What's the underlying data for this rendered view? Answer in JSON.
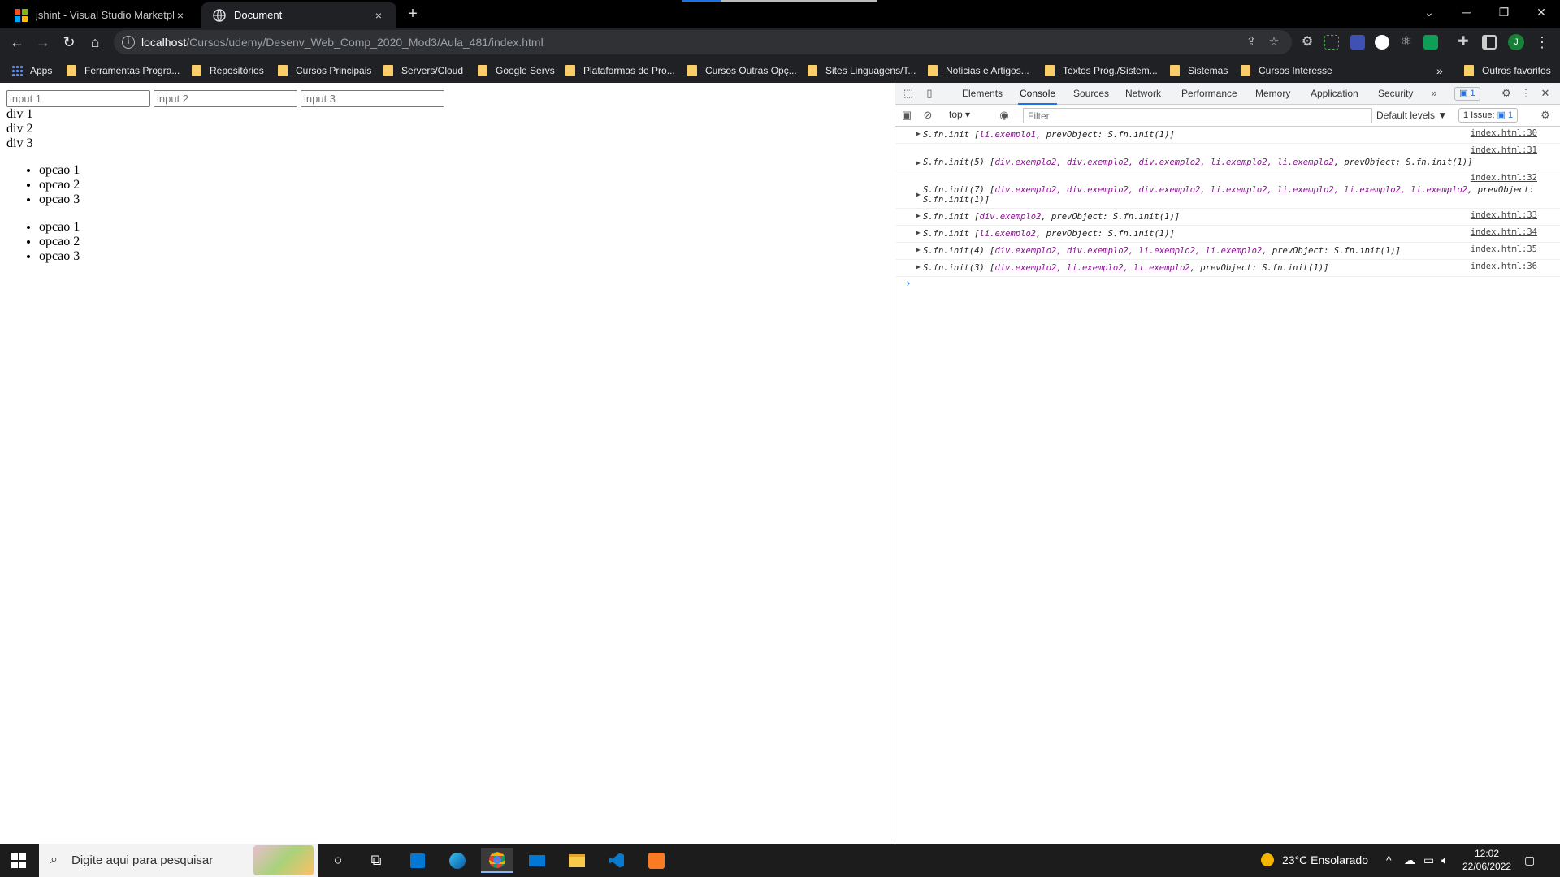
{
  "browser": {
    "tabs": [
      {
        "title": "jshint - Visual Studio Marketplace",
        "close": "×"
      },
      {
        "title": "Document",
        "close": "×"
      }
    ],
    "new_tab": "+",
    "url": {
      "host": "localhost",
      "path": "/Cursos/udemy/Desenv_Web_Comp_2020_Mod3/Aula_481/index.html"
    },
    "profile_initial": "J",
    "bookmarks": [
      "Apps",
      "Ferramentas Progra...",
      "Repositórios",
      "Cursos Principais",
      "Servers/Cloud",
      "Google Servs",
      "Plataformas de Pro...",
      "Cursos Outras Opç...",
      "Sites Linguagens/T...",
      "Noticias e Artigos...",
      "Textos Prog./Sistem...",
      "Sistemas",
      "Cursos Interesse"
    ],
    "bookmarks_more": "»",
    "other_bookmarks": "Outros favoritos"
  },
  "page": {
    "inputs": [
      {
        "placeholder": "input 1"
      },
      {
        "placeholder": "input 2"
      },
      {
        "placeholder": "input 3"
      }
    ],
    "divs": [
      "div 1",
      "div 2",
      "div 3"
    ],
    "list1": [
      "opcao 1",
      "opcao 2",
      "opcao 3"
    ],
    "list2": [
      "opcao 1",
      "opcao 2",
      "opcao 3"
    ]
  },
  "devtools": {
    "tabs": [
      "Elements",
      "Console",
      "Sources",
      "Network",
      "Performance",
      "Memory",
      "Application",
      "Security"
    ],
    "active_tab": "Console",
    "more_tabs": "»",
    "messages_badge": "1",
    "context": "top",
    "filter_placeholder": "Filter",
    "levels": "Default levels ▼",
    "issues": {
      "label": "1 Issue:",
      "count": "1"
    },
    "console": [
      {
        "text_pre": "S.fn.init [",
        "items": "li.exemplo1",
        "text_post": ", prevObject: S.fn.init(1)]",
        "src": "index.html:30"
      },
      {
        "text_pre": "S.fn.init(5) [",
        "items": "div.exemplo2, div.exemplo2, div.exemplo2, li.exemplo2, li.exemplo2",
        "text_post": ", prevObject: S.fn.init(1)]",
        "src": "index.html:31"
      },
      {
        "text_pre": "S.fn.init(7) [",
        "items": "div.exemplo2, div.exemplo2, div.exemplo2, li.exemplo2, li.exemplo2, li.exemplo2, li.exemplo2",
        "text_post": ", prevObject: S.fn.init(1)]",
        "src": "index.html:32"
      },
      {
        "text_pre": "S.fn.init [",
        "items": "div.exemplo2",
        "text_post": ", prevObject: S.fn.init(1)]",
        "src": "index.html:33"
      },
      {
        "text_pre": "S.fn.init [",
        "items": "li.exemplo2",
        "text_post": ", prevObject: S.fn.init(1)]",
        "src": "index.html:34"
      },
      {
        "text_pre": "S.fn.init(4) [",
        "items": "div.exemplo2, div.exemplo2, li.exemplo2, li.exemplo2",
        "text_post": ", prevObject: S.fn.init(1)]",
        "src": "index.html:35"
      },
      {
        "text_pre": "S.fn.init(3) [",
        "items": "div.exemplo2, li.exemplo2, li.exemplo2",
        "text_post": ", prevObject: S.fn.init(1)]",
        "src": "index.html:36"
      }
    ],
    "prompt": "›"
  },
  "taskbar": {
    "search_placeholder": "Digite aqui para pesquisar",
    "weather": "23°C  Ensolarado",
    "time": "12:02",
    "date": "22/06/2022"
  }
}
